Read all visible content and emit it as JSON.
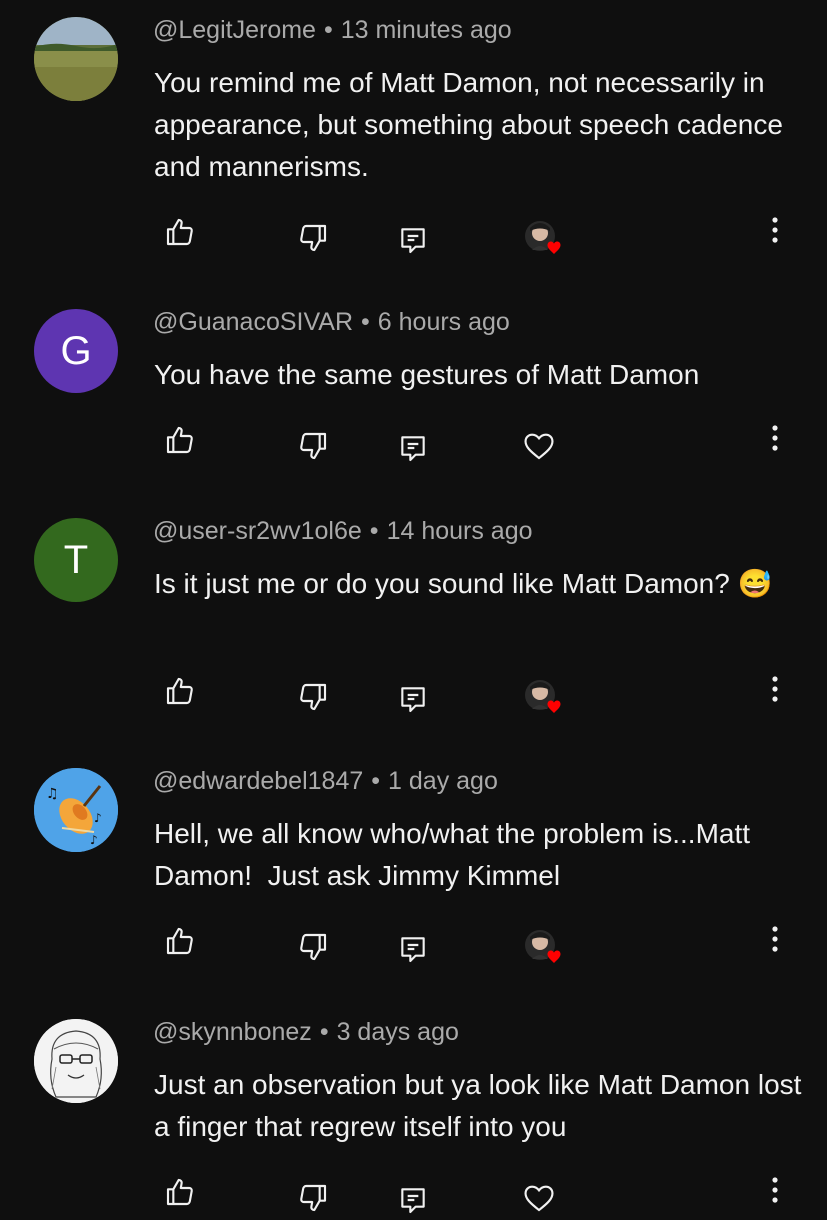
{
  "comments": [
    {
      "handle": "@LegitJerome",
      "time": "13 minutes ago",
      "text": "You remind me of Matt Damon, not necessarily in appearance, but something about speech cadence and mannerisms.",
      "avatar": {
        "type": "image",
        "icon": "landscape-avatar"
      },
      "creator_heart": true
    },
    {
      "handle": "@GuanacoSIVAR",
      "time": "6 hours ago",
      "text": "You have the same gestures of Matt Damon",
      "avatar": {
        "type": "letter",
        "letter": "G",
        "color": "#5e35b1"
      },
      "creator_heart": false
    },
    {
      "handle": "@user-sr2wv1ol6e",
      "time": "14 hours ago",
      "text": "Is it just me or do you sound like Matt Damon? 😅",
      "avatar": {
        "type": "letter",
        "letter": "T",
        "color": "#33691e"
      },
      "creator_heart": true
    },
    {
      "handle": "@edwardebel1847",
      "time": "1 day ago",
      "text": "Hell, we all know who/what the problem is...Matt Damon!  Just ask Jimmy Kimmel",
      "avatar": {
        "type": "image",
        "icon": "violin-avatar"
      },
      "creator_heart": true
    },
    {
      "handle": "@skynnbonez",
      "time": "3 days ago",
      "text": "Just an observation but ya look like Matt Damon lost a finger that regrew itself into you",
      "avatar": {
        "type": "image",
        "icon": "sketch-portrait-avatar"
      },
      "creator_heart": false
    }
  ],
  "meta_separator": "•",
  "colors": {
    "background": "#0f0f0f",
    "text": "#f1f1f1",
    "meta": "#aaaaaa",
    "heart": "#ff0000"
  }
}
